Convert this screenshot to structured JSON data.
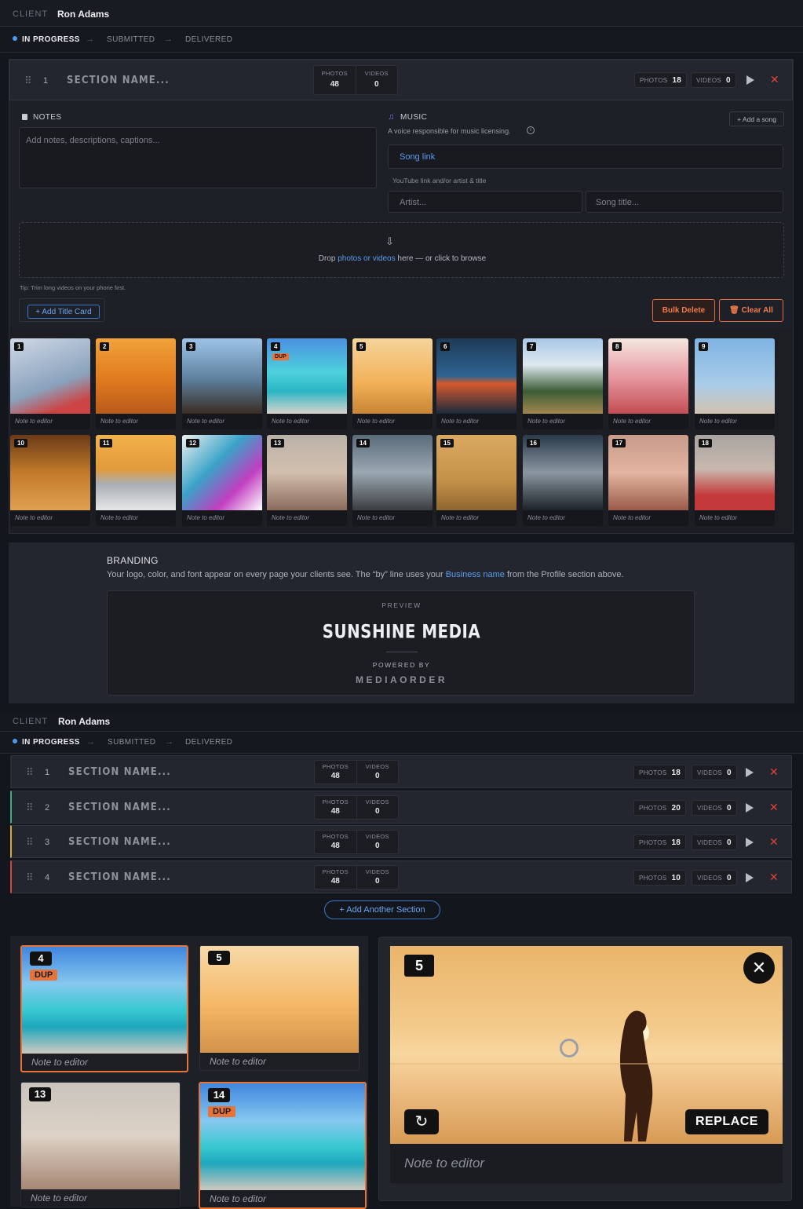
{
  "client": {
    "label": "CLIENT",
    "name": "Ron Adams"
  },
  "steps": [
    "IN PROGRESS",
    "SUBMITTED",
    "DELIVERED"
  ],
  "section_top": {
    "number": "1",
    "name_placeholder": "SECTION NAME...",
    "photos_label": "PHOTOS",
    "photos_total": "48",
    "videos_label": "VIDEOS",
    "videos_total": "0",
    "photos_count": "18",
    "videos_count": "0"
  },
  "notes": {
    "label": "NOTES",
    "placeholder": "Add notes, descriptions, captions..."
  },
  "music": {
    "label": "MUSIC",
    "subtitle": "A voice responsible for music licensing.",
    "add_song": "+ Add a song",
    "song_link": "Song link",
    "hint": "YouTube link and/or artist & title",
    "artist_placeholder": "Artist...",
    "title_placeholder": "Song title..."
  },
  "dropzone": {
    "prefix": "Drop ",
    "link": "photos or videos",
    "suffix": " here — or click to browse"
  },
  "tip": "Tip: Trim long videos on your phone first.",
  "buttons": {
    "add_title_card": "+ Add Title Card",
    "bulk_delete": "Bulk Delete",
    "clear_all": "Clear All",
    "add_section": "+ Add Another Section"
  },
  "tiles": [
    {
      "n": "1",
      "note": "Note to editor"
    },
    {
      "n": "2",
      "note": "Note to editor"
    },
    {
      "n": "3",
      "note": "Note to editor"
    },
    {
      "n": "4",
      "note": "Note to editor",
      "dup": "DUP"
    },
    {
      "n": "5",
      "note": "Note to editor"
    },
    {
      "n": "6",
      "note": "Note to editor"
    },
    {
      "n": "7",
      "note": "Note to editor"
    },
    {
      "n": "8",
      "note": "Note to editor"
    },
    {
      "n": "9",
      "note": "Note to editor"
    },
    {
      "n": "10",
      "note": "Note to editor"
    },
    {
      "n": "11",
      "note": "Note to editor"
    },
    {
      "n": "12",
      "note": "Note to editor"
    },
    {
      "n": "13",
      "note": "Note to editor"
    },
    {
      "n": "14",
      "note": "Note to editor"
    },
    {
      "n": "15",
      "note": "Note to editor"
    },
    {
      "n": "16",
      "note": "Note to editor"
    },
    {
      "n": "17",
      "note": "Note to editor"
    },
    {
      "n": "18",
      "note": "Note to editor"
    }
  ],
  "branding": {
    "title": "BRANDING",
    "desc_prefix": "Your logo, color, and font appear on every page your clients see. The “by” line uses your ",
    "desc_link": "Business name",
    "desc_suffix": " from the Profile section above.",
    "preview_label": "PREVIEW",
    "brand_name": "SUNSHINE MEDIA",
    "powered_by": "POWERED BY",
    "platform": "MEDIAORDER"
  },
  "sections": [
    {
      "number": "1",
      "name": "SECTION NAME...",
      "photos_total": "48",
      "videos_total": "0",
      "photos": "18",
      "videos": "0",
      "accent": "#2a2d36"
    },
    {
      "number": "2",
      "name": "SECTION NAME...",
      "photos_total": "48",
      "videos_total": "0",
      "photos": "20",
      "videos": "0",
      "accent": "#3fae7a"
    },
    {
      "number": "3",
      "name": "SECTION NAME...",
      "photos_total": "48",
      "videos_total": "0",
      "photos": "18",
      "videos": "0",
      "accent": "#d6a93a"
    },
    {
      "number": "4",
      "name": "SECTION NAME...",
      "photos_total": "48",
      "videos_total": "0",
      "photos": "10",
      "videos": "0",
      "accent": "#d6453a"
    }
  ],
  "zoom_tiles": [
    {
      "n": "4",
      "dup": "DUP",
      "note": "Note to editor"
    },
    {
      "n": "5",
      "note": "Note to editor"
    },
    {
      "n": "13",
      "note": "Note to editor"
    },
    {
      "n": "14",
      "dup": "DUP",
      "note": "Note to editor"
    }
  ],
  "lightbox": {
    "n": "5",
    "replace": "REPLACE",
    "note_placeholder": "Note to editor"
  },
  "colors": {
    "accent": "#4a9cf0",
    "danger": "#e1433a",
    "dup": "#e8733a"
  }
}
